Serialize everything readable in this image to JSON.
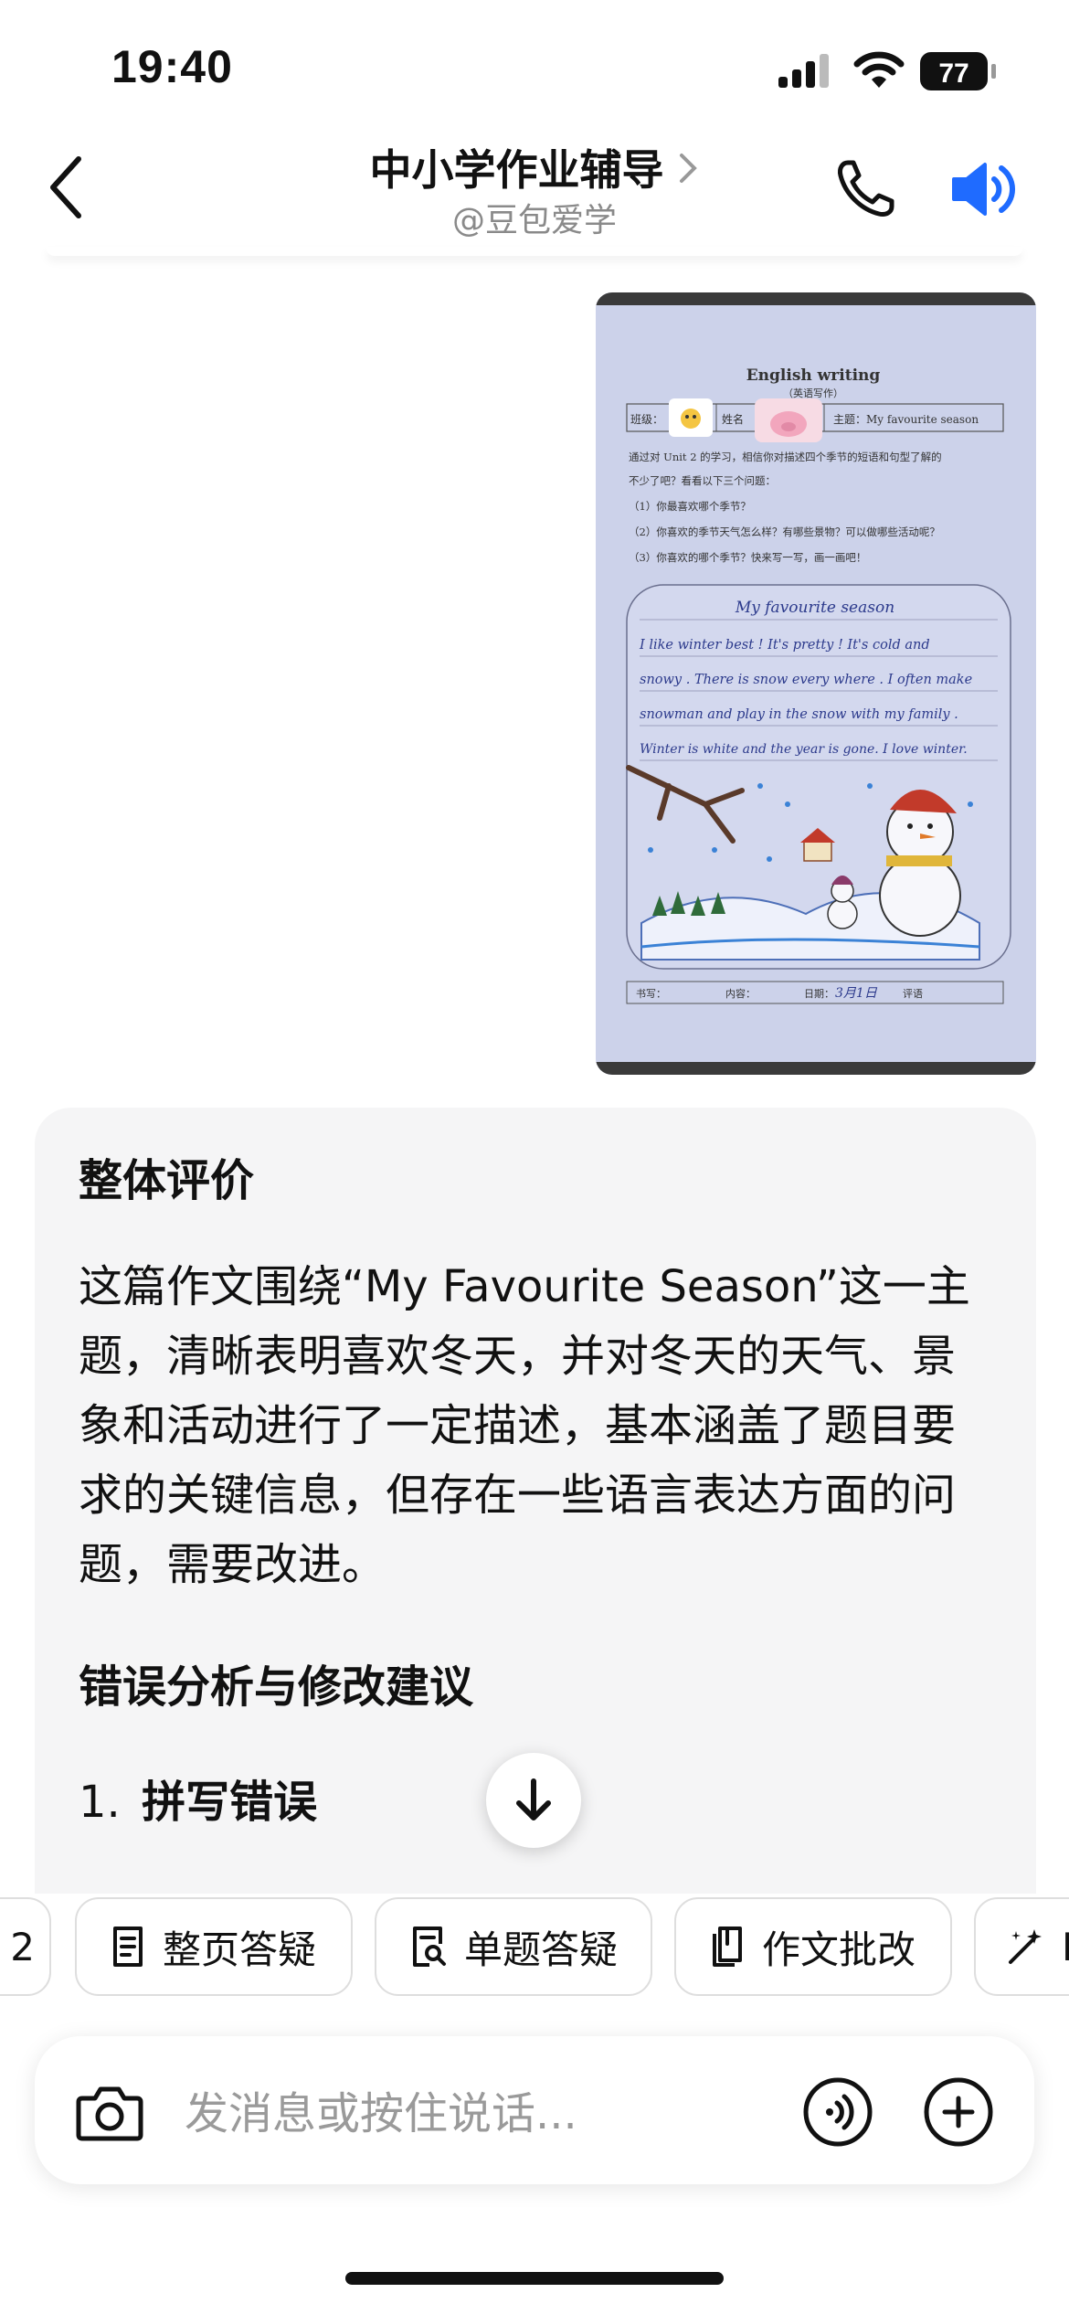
{
  "status_bar": {
    "time": "19:40",
    "battery": "77"
  },
  "header": {
    "title": "中小学作业辅导",
    "subtitle": "@豆包爱学"
  },
  "homework_photo": {
    "heading": "English writing",
    "subheading": "（英语写作）",
    "field_class": "班级：",
    "field_name": "姓名",
    "field_topic": "主题：My favourite season",
    "prompt_1": "通过对 Unit 2 的学习，相信你对描述四个季节的短语和句型了解的",
    "prompt_2": "不少了吧？看看以下三个问题：",
    "q1": "（1）你最喜欢哪个季节？",
    "q2": "（2）你喜欢的季节天气怎么样？有哪些景物？可以做哪些活动呢？",
    "q3": "（3）你喜欢的哪个季节？快来写一写，画一画吧！",
    "essay_title": "My favourite season",
    "essay_lines": [
      "I like winter best ! It's pretty ! It's cold and",
      "snowy . There is snow every where . I often make",
      "snowman and play in the snow with my family .",
      "Winter is white and the year is gone. I love winter."
    ],
    "footer_writing": "书写：",
    "footer_content": "内容：",
    "footer_date_label": "日期：",
    "footer_date": "3月1日",
    "footer_comment": "评语"
  },
  "answer": {
    "section1_heading": "整体评价",
    "section1_body": "这篇作文围绕“My Favourite Season”这一主题，清晰表明喜欢冬天，并对冬天的天气、景象和活动进行了一定描述，基本涵盖了题目要求的关键信息，但存在一些语言表达方面的问题，需要改进。",
    "section2_heading": "错误分析与修改建议",
    "item1_number": "1.",
    "item1_heading": "拼写错误"
  },
  "chips": {
    "partial_left": "2",
    "page_qa": "整页答疑",
    "single_qa": "单题答疑",
    "essay_review": "作文批改",
    "partial_right": "I"
  },
  "input": {
    "placeholder": "发消息或按住说话..."
  },
  "colors": {
    "accent_blue": "#1f6bff",
    "card_bg": "#f5f5f6",
    "paper_bg": "#ccd2ea"
  }
}
